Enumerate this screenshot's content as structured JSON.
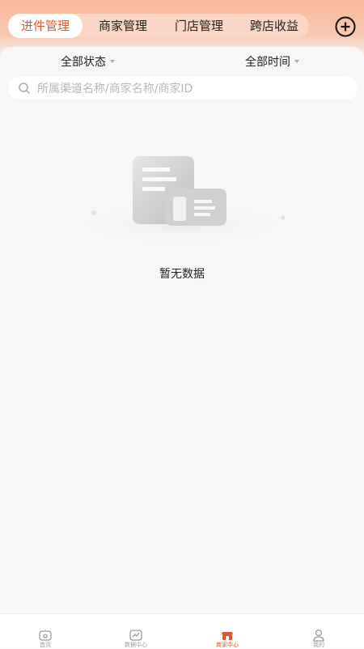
{
  "tabs": [
    {
      "label": "进件管理",
      "active": true
    },
    {
      "label": "商家管理",
      "active": false
    },
    {
      "label": "门店管理",
      "active": false
    },
    {
      "label": "跨店收益",
      "active": false
    }
  ],
  "filters": {
    "status": "全部状态",
    "time": "全部时间"
  },
  "search": {
    "placeholder": "所属渠道名称/商家名称/商家ID",
    "value": ""
  },
  "empty": {
    "text": "暂无数据"
  },
  "bottom_nav": [
    {
      "label": "首页",
      "icon": "home-icon",
      "active": false
    },
    {
      "label": "数据中心",
      "icon": "chart-icon",
      "active": false
    },
    {
      "label": "商家中心",
      "icon": "store-icon",
      "active": true
    },
    {
      "label": "我的",
      "icon": "user-icon",
      "active": false
    }
  ],
  "colors": {
    "accent": "#e6542a",
    "header": "#f8b79a",
    "tab_bar": "#f9d6c5",
    "background": "#f7f7f7"
  }
}
